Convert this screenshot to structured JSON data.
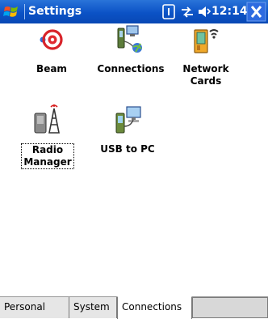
{
  "title_bar": {
    "app_title": "Settings",
    "clock": "12:14",
    "start_icon": "windows-start-flag-icon",
    "status_icons": [
      "input-panel-icon",
      "connectivity-icon",
      "volume-icon"
    ],
    "close_icon": "close-icon",
    "colors": {
      "background": "#0b52c6",
      "close": "#2e6be0"
    }
  },
  "icons": [
    {
      "label": "Beam",
      "icon": "beam-icon"
    },
    {
      "label": "Connections",
      "icon": "connections-icon"
    },
    {
      "label": "Network Cards",
      "label_lines": [
        "Network",
        "Cards"
      ],
      "icon": "network-cards-icon"
    },
    {
      "label": "Radio Manager",
      "label_lines": [
        "Radio",
        "Manager"
      ],
      "icon": "radio-manager-icon",
      "focused": true
    },
    {
      "label": "USB to PC",
      "icon": "usb-to-pc-icon"
    }
  ],
  "tabs": [
    {
      "label": "Personal",
      "active": false
    },
    {
      "label": "System",
      "active": false
    },
    {
      "label": "Connections",
      "active": true
    }
  ]
}
